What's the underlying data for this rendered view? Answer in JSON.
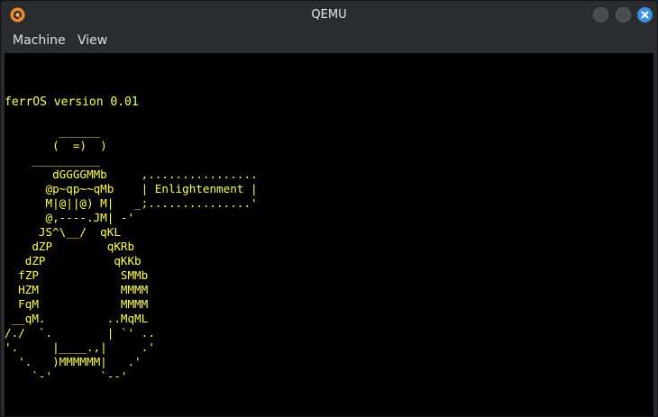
{
  "window": {
    "title": "QEMU",
    "app_icon": "qemu-logo",
    "controls": [
      "minimize",
      "maximize",
      "close"
    ],
    "accent": "#3d8fe0"
  },
  "menubar": {
    "items": [
      {
        "label": "Machine"
      },
      {
        "label": "View"
      }
    ]
  },
  "screen": {
    "background": "#000000",
    "text_color": "#ffff55",
    "version_line": "ferrOS version 0.01",
    "ascii_art": "        ______\n       (  =)  )\n    __________\n       dGGGGMMb     ,................\n      @p~qp~~qMb    | Enlightenment |\n      M|@||@) M|   _;...............'\n      @,----.JM| -'\n     JS^\\__/  qKL\n    dZP        qKRb\n   dZP          qKKb\n  fZP            SMMb\n  HZM            MMMM\n  FqM            MMMM\n __qM.         ..MqML\n/./  `.        | `' ..\n'.     |____.,|     .'\n  '.   )MMMMMM|   .'\n    `-'       `--'"
  }
}
